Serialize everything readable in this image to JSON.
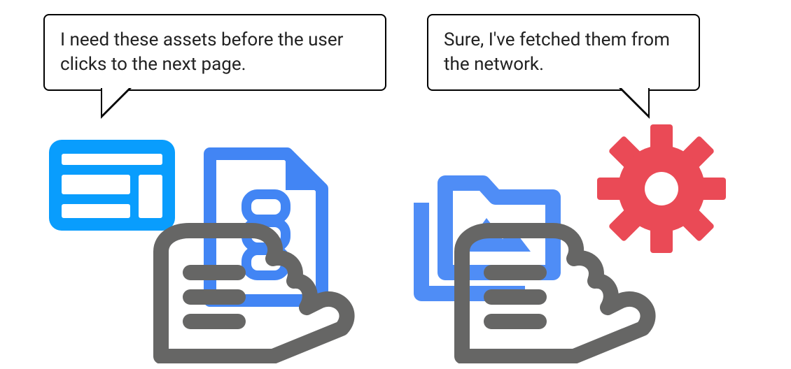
{
  "diagram": {
    "left_bubble_text": "I need these assets before the user clicks to the next page.",
    "right_bubble_text": "Sure, I've fetched them from the network.",
    "colors": {
      "browser_blue": "#099DFD",
      "doc_blue": "#4285F4",
      "folder_blue": "#4F8DF6",
      "hand_gray": "#666665",
      "gear_red": "#EA4A56"
    }
  }
}
